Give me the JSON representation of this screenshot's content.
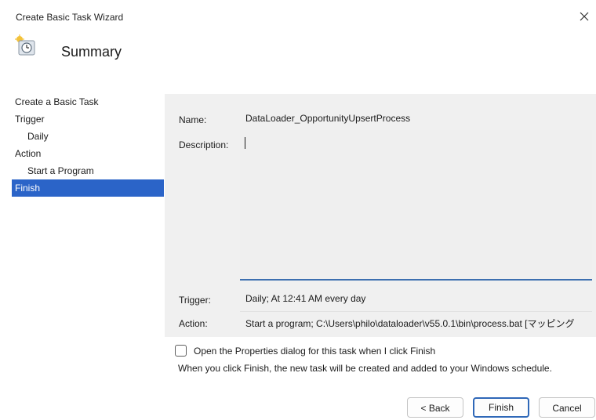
{
  "window": {
    "title": "Create Basic Task Wizard",
    "close_glyph": "×",
    "close_icon": "close-icon"
  },
  "header": {
    "title": "Summary",
    "icon": "clock-task-icon"
  },
  "nav": {
    "items": [
      {
        "label": "Create a Basic Task",
        "level": 0,
        "active": false
      },
      {
        "label": "Trigger",
        "level": 0,
        "active": false
      },
      {
        "label": "Daily",
        "level": 1,
        "active": false
      },
      {
        "label": "Action",
        "level": 0,
        "active": false
      },
      {
        "label": "Start a Program",
        "level": 1,
        "active": false
      },
      {
        "label": "Finish",
        "level": 0,
        "active": true
      }
    ]
  },
  "summary": {
    "name_label": "Name:",
    "name_value": "DataLoader_OpportunityUpsertProcess",
    "description_label": "Description:",
    "description_value": "",
    "trigger_label": "Trigger:",
    "trigger_value": "Daily; At 12:41 AM every day",
    "action_label": "Action:",
    "action_value": "Start a program; C:\\Users\\philo\\dataloader\\v55.0.1\\bin\\process.bat [マッピング"
  },
  "options": {
    "open_properties_label": "Open the Properties dialog for this task when I click Finish",
    "open_properties_checked": false,
    "info_text": "When you click Finish, the new task will be created and added to your Windows schedule."
  },
  "buttons": {
    "back": "< Back",
    "finish": "Finish",
    "cancel": "Cancel"
  },
  "colors": {
    "selection": "#2b64c8",
    "accent_border": "#2f68b8",
    "panel_bg": "#f0f0f0"
  }
}
